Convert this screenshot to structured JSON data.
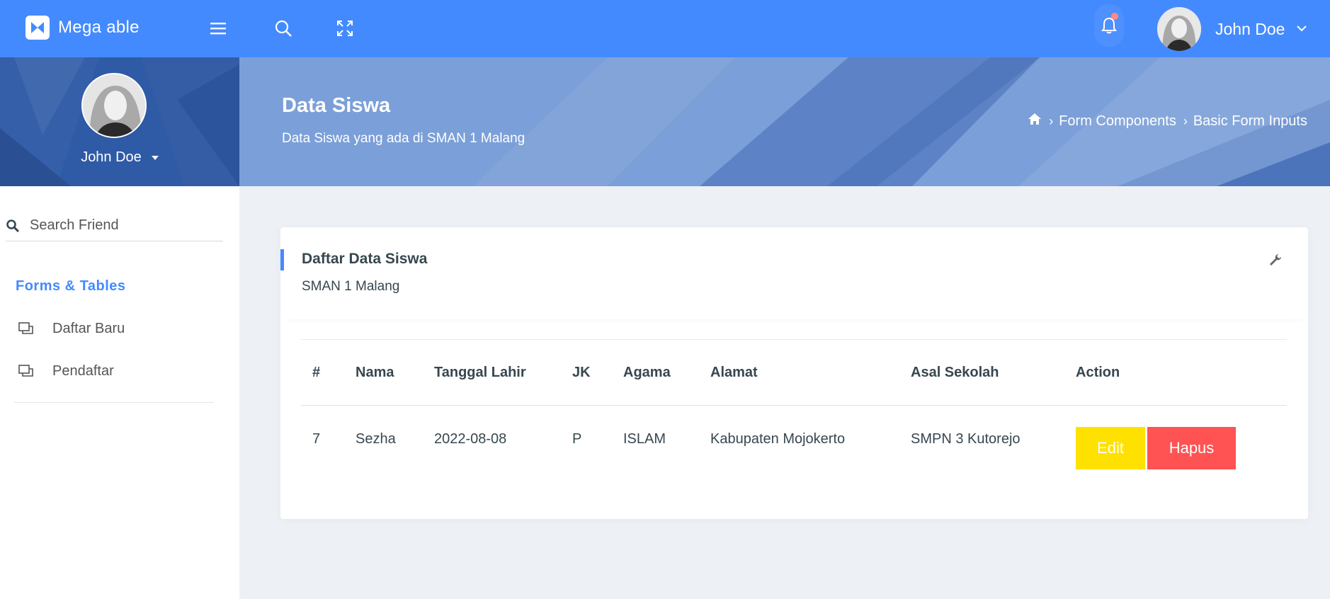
{
  "brand": {
    "name": "Mega able"
  },
  "navbar": {
    "icons": [
      "menu-icon",
      "search-icon",
      "fullscreen-icon",
      "bell-icon"
    ],
    "user_name": "John Doe"
  },
  "sidebar": {
    "profile_name": "John Doe",
    "search_placeholder": "Search Friend",
    "section_label": "Forms & Tables",
    "items": [
      {
        "label": "Daftar Baru",
        "icon": "window-icon"
      },
      {
        "label": "Pendaftar",
        "icon": "window-icon"
      }
    ]
  },
  "page_header": {
    "title": "Data Siswa",
    "subtitle": "Data Siswa yang ada di SMAN 1 Malang",
    "breadcrumb": [
      "Form Components",
      "Basic Form Inputs"
    ]
  },
  "card": {
    "title": "Daftar Data Siswa",
    "subtitle": "SMAN 1 Malang",
    "table": {
      "headers": [
        "#",
        "Nama",
        "Tanggal Lahir",
        "JK",
        "Agama",
        "Alamat",
        "Asal Sekolah",
        "Action"
      ],
      "rows": [
        {
          "no": "7",
          "nama": "Sezha",
          "tanggal_lahir": "2022-08-08",
          "jk": "P",
          "agama": "ISLAM",
          "alamat": "Kabupaten Mojokerto",
          "asal_sekolah": "SMPN 3 Kutorejo",
          "edit_label": "Edit",
          "delete_label": "Hapus"
        }
      ]
    }
  },
  "colors": {
    "primary": "#448aff",
    "header_bg": "#7b9fd8",
    "sidebar_profile_bg": "#2e5aa6",
    "edit_button": "#ffe100",
    "delete_button": "#ff5252",
    "page_bg": "#edf1f5"
  }
}
